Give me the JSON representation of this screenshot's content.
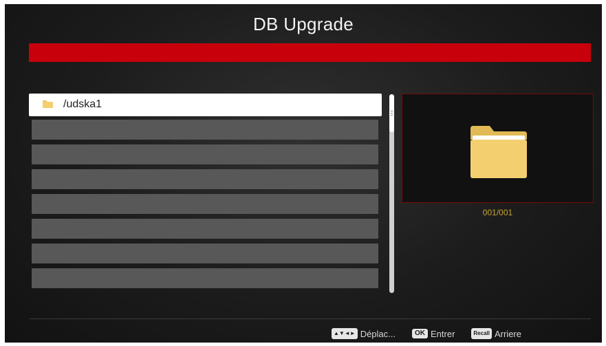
{
  "header": {
    "title": "DB Upgrade"
  },
  "file_list": {
    "items": [
      {
        "label": "/udska1",
        "icon": "folder-icon",
        "selected": true
      },
      {
        "label": ""
      },
      {
        "label": ""
      },
      {
        "label": ""
      },
      {
        "label": ""
      },
      {
        "label": ""
      },
      {
        "label": ""
      },
      {
        "label": ""
      }
    ]
  },
  "preview": {
    "icon": "folder-icon",
    "counter": "001/001"
  },
  "footer": {
    "nav_key": "▲▼◄►",
    "nav_label": "Déplac...",
    "ok_key": "OK",
    "ok_label": "Entrer",
    "recall_key": "Recall",
    "recall_label": "Arriere"
  },
  "colors": {
    "accent_bar": "#c8000b",
    "counter_text": "#c9a431",
    "folder": "#f3cf6f"
  }
}
